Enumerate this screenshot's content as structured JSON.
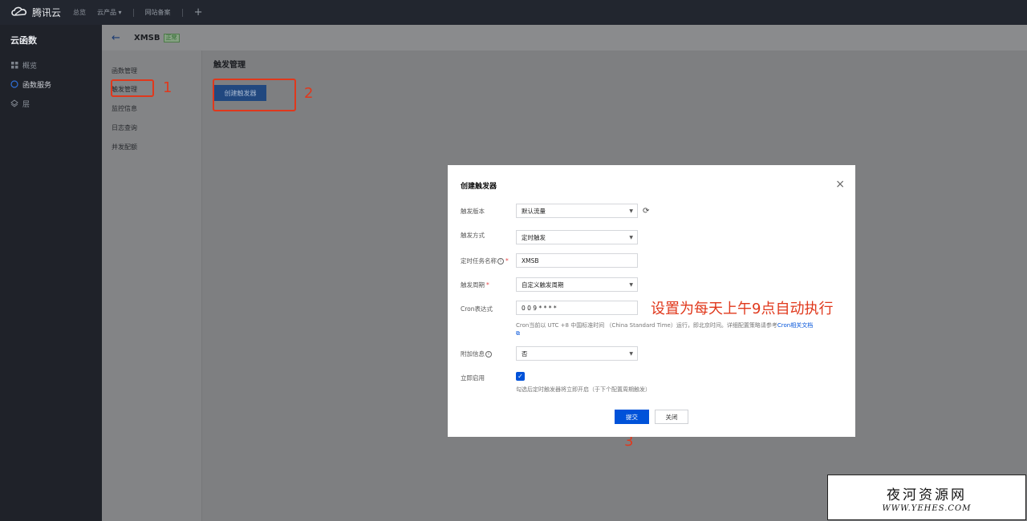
{
  "topbar": {
    "brand": "腾讯云",
    "nav": [
      "总览",
      "云产品 ▾",
      "网站备案"
    ],
    "plus": "+"
  },
  "sidebar": {
    "title": "云函数",
    "items": [
      {
        "label": "概览",
        "icon": "grid-icon"
      },
      {
        "label": "函数服务",
        "icon": "function-icon"
      },
      {
        "label": "层",
        "icon": "layers-icon"
      }
    ]
  },
  "header": {
    "back": "←",
    "function_name": "XMSB",
    "status": "正常"
  },
  "subnav": {
    "items": [
      "函数管理",
      "触发管理",
      "监控信息",
      "日志查询",
      "并发配额"
    ]
  },
  "content": {
    "title": "触发管理",
    "create_button": "创建触发器"
  },
  "annotations": {
    "n1": "1",
    "n2": "2",
    "n3": "3",
    "cron_note": "设置为每天上午9点自动执行"
  },
  "modal": {
    "title": "创建触发器",
    "close": "×",
    "version_label": "触发版本",
    "version_value": "默认流量",
    "method_label": "触发方式",
    "method_value": "定时触发",
    "task_name_label": "定时任务名称",
    "task_name_value": "XMSB",
    "period_label": "触发周期",
    "period_value": "自定义触发周期",
    "cron_label": "Cron表达式",
    "cron_value": "0 0 9 * * * *",
    "cron_hint": "Cron当前以 UTC +8 中国标准时间 （China Standard Time）运行，即北京时间。详细配置策略请参考",
    "cron_hint_link": "Cron相关文档",
    "extra_label": "附加信息",
    "extra_value": "否",
    "enable_label": "立即启用",
    "enable_hint": "勾选后定时触发器将立即开启（于下个配置周期触发）",
    "submit": "提交",
    "cancel": "关闭"
  },
  "watermark": {
    "line1": "夜河资源网",
    "line2": "WWW.YEHES.COM"
  },
  "colors": {
    "primary": "#0052d9",
    "annotation": "#e0381c"
  }
}
